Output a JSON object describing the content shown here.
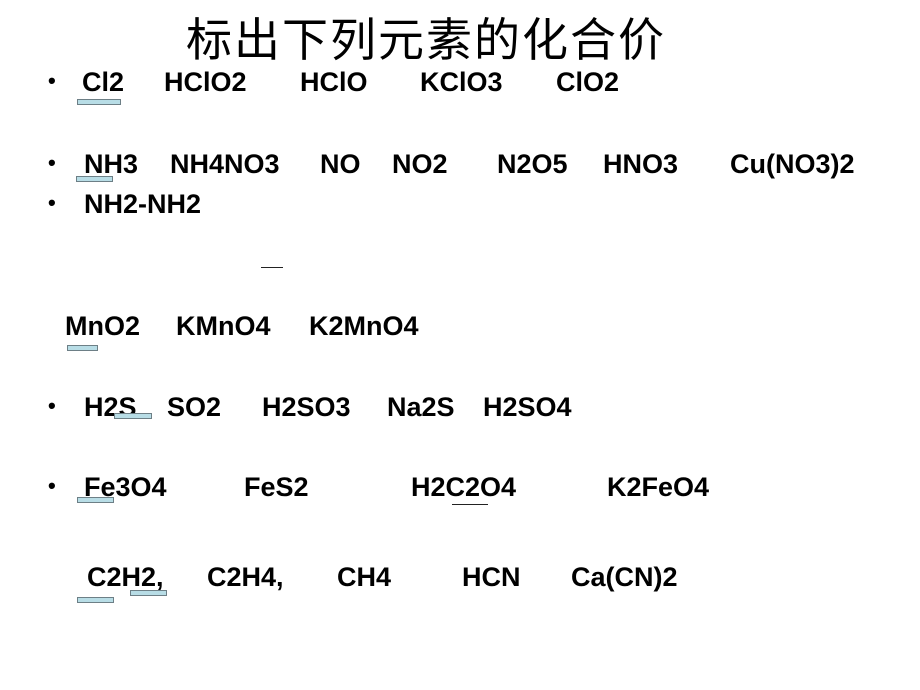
{
  "title": "标出下列元素的化合价",
  "rows": [
    {
      "bullet": "•",
      "items": [
        "Cl2",
        "HClO2",
        "HClO",
        "KClO3",
        "ClO2"
      ]
    },
    {
      "bullet": "•",
      "items": [
        "NH3",
        "NH4NO3",
        "NO",
        "NO2",
        "N2O5",
        "HNO3",
        "Cu(NO3)2"
      ]
    },
    {
      "bullet": "•",
      "items": [
        "NH2-NH2"
      ]
    },
    {
      "bullet": "",
      "items": [
        "MnO2",
        "KMnO4",
        "K2MnO4"
      ]
    },
    {
      "bullet": "•",
      "items": [
        "H2S",
        "SO2",
        "H2SO3",
        "Na2S",
        "H2SO4"
      ]
    },
    {
      "bullet": "•",
      "items": [
        "Fe3O4",
        "FeS2",
        "H2C2O4",
        "K2FeO4"
      ]
    },
    {
      "bullet": "",
      "items": [
        "C2H2,",
        "C2H4,",
        "CH4",
        "HCN",
        "Ca(CN)2"
      ]
    }
  ],
  "colors": {
    "highlight_fill": "#b8dde6",
    "highlight_border": "#6d7f86",
    "text": "#000000"
  }
}
